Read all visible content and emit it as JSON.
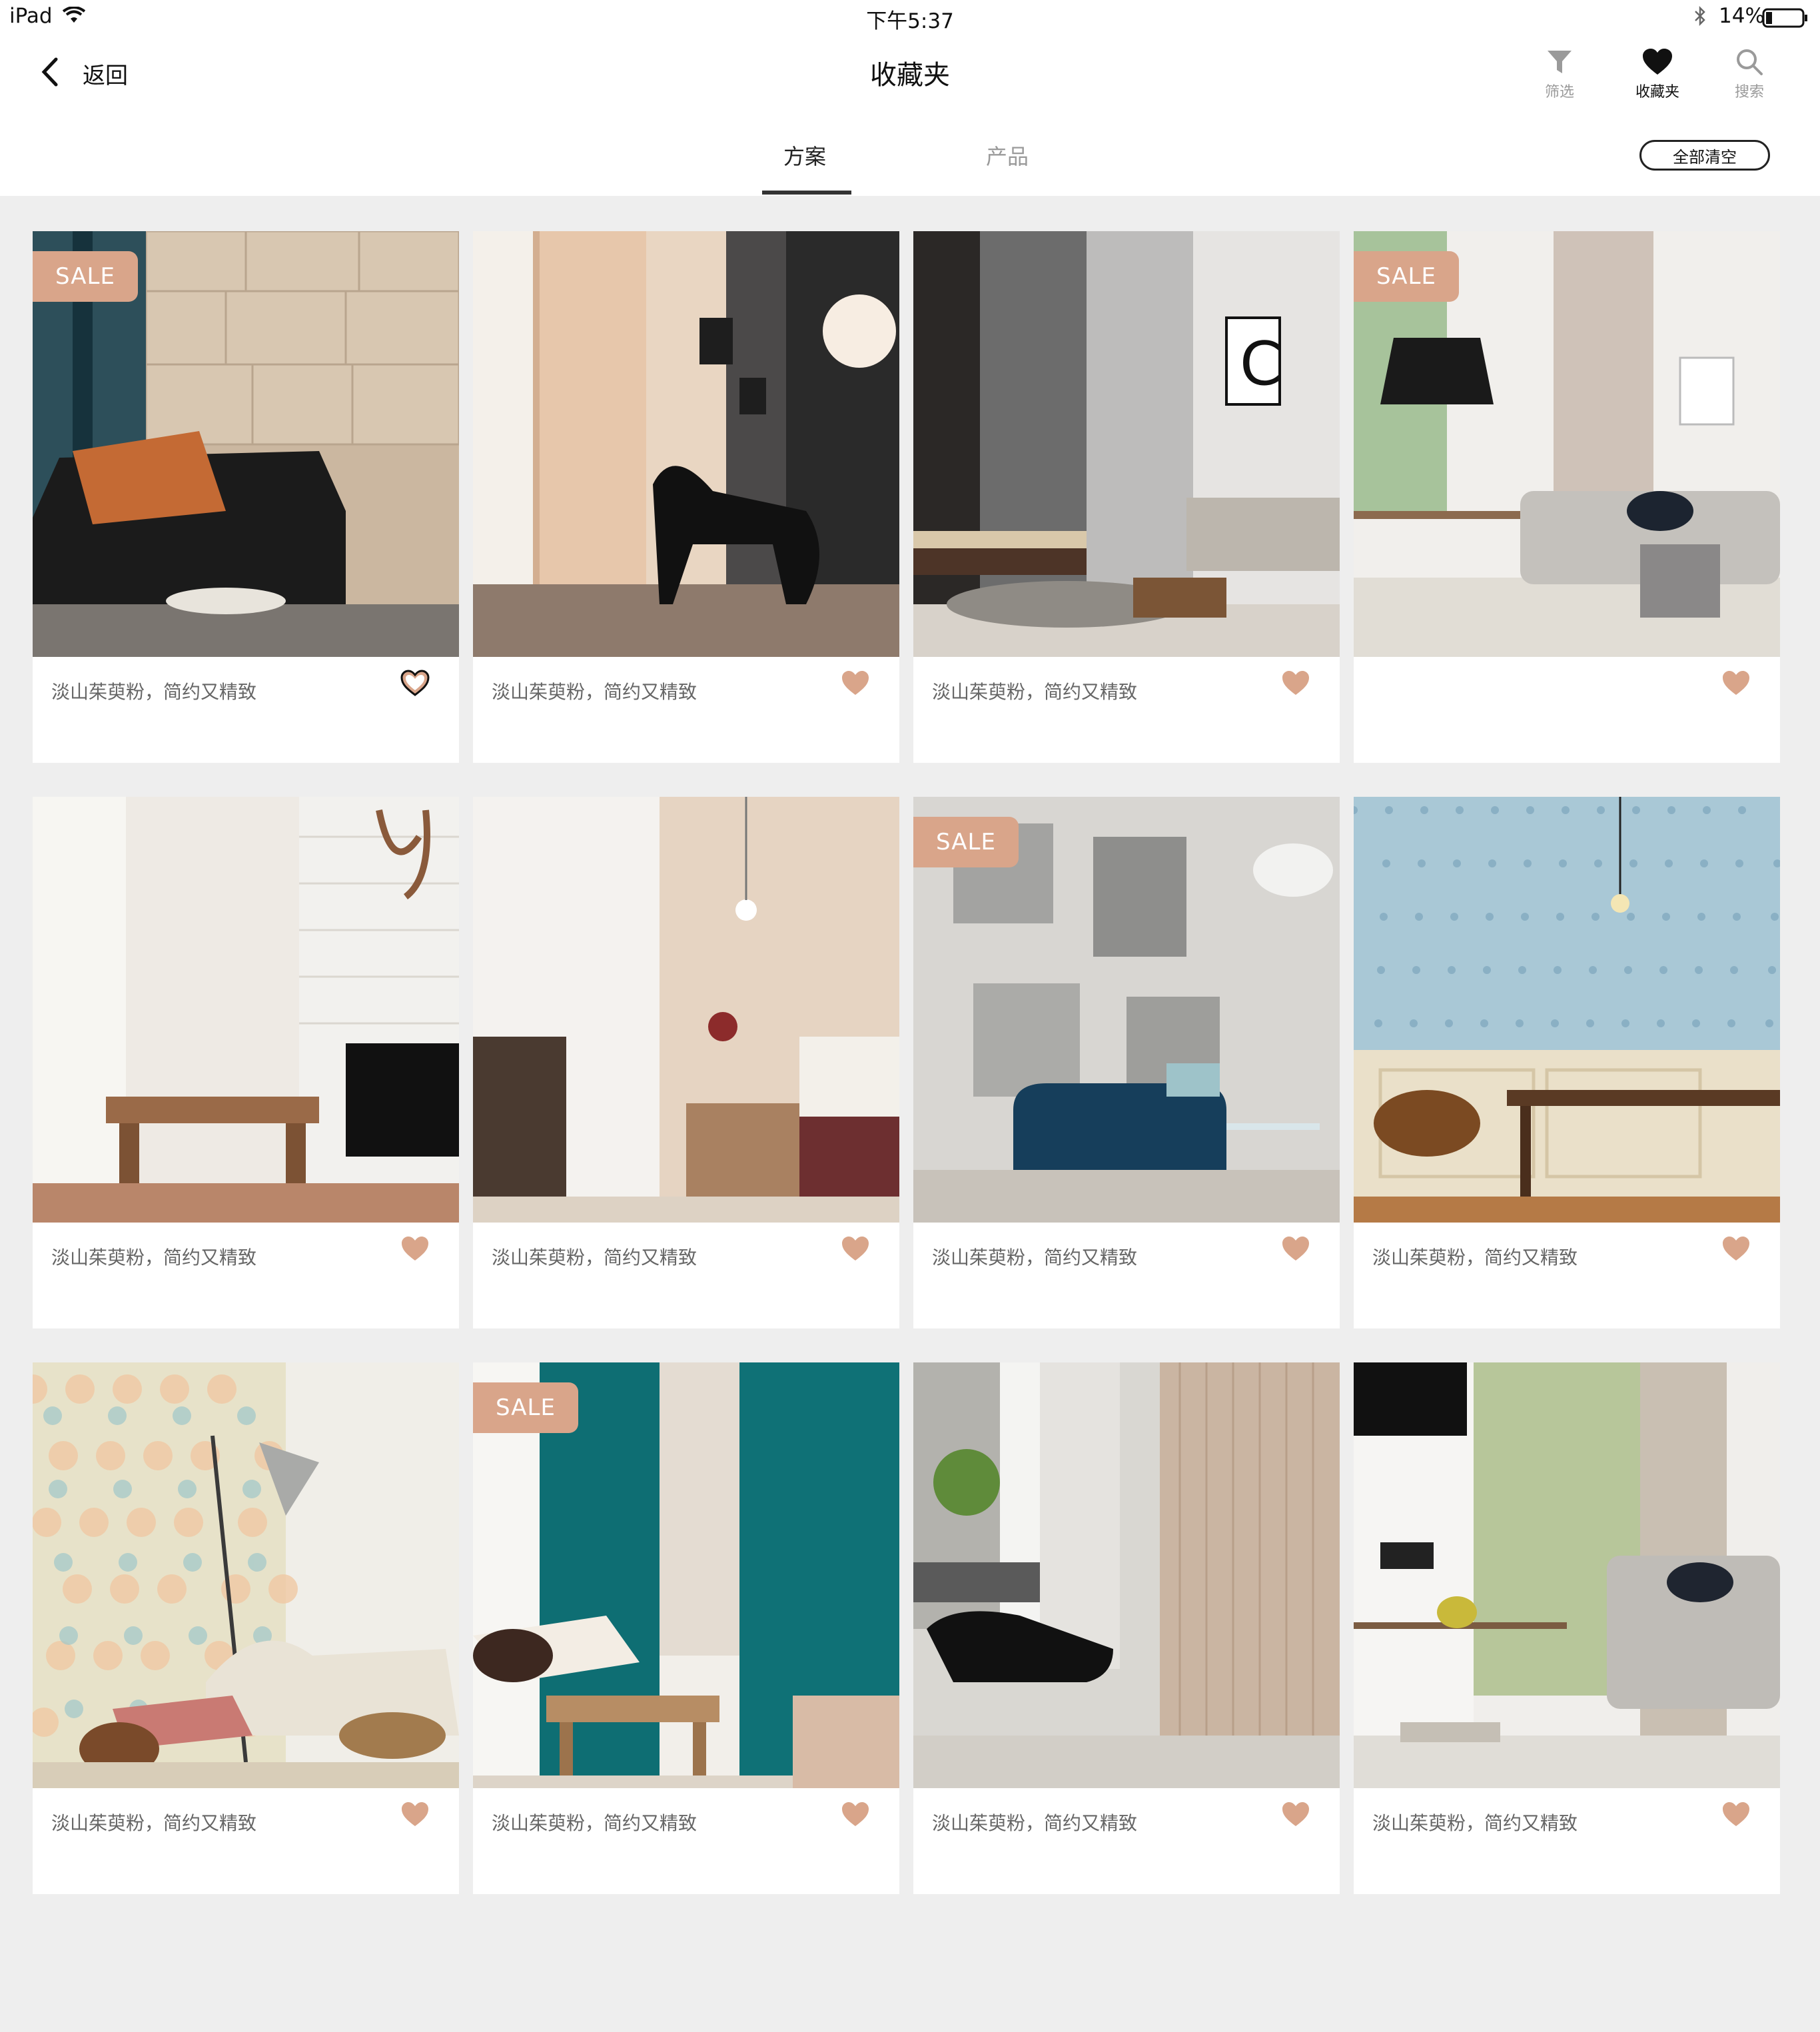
{
  "status_bar": {
    "device": "iPad",
    "time": "下午5:37",
    "battery_percent": "14%"
  },
  "nav": {
    "back_label": "返回",
    "title": "收藏夹",
    "tools": {
      "filter": "筛选",
      "favorites": "收藏夹",
      "search": "搜索"
    }
  },
  "tabs": {
    "plans": "方案",
    "products": "产品",
    "active": "plans"
  },
  "clear_all_label": "全部清空",
  "colors": {
    "accent_heart": "#d9a58a",
    "sale_badge": "#d9a58a",
    "background": "#eeeeee"
  },
  "icons": {
    "back": "chevron-left-icon",
    "filter": "funnel-icon",
    "favorites": "heart-icon",
    "search": "search-icon",
    "wifi": "wifi-icon",
    "bluetooth": "bluetooth-icon",
    "battery": "battery-icon"
  },
  "cards": [
    {
      "caption": "淡山茱萸粉，简约又精致",
      "sale": "SALE",
      "favorited": false,
      "scene": "black leather sofa, stone tile wall"
    },
    {
      "caption": "淡山茱萸粉，简约又精致",
      "sale": "",
      "favorited": true,
      "scene": "peach sheer curtains, lounge chair"
    },
    {
      "caption": "淡山茱萸粉，简约又精致",
      "sale": "",
      "favorited": true,
      "scene": "grey striped curtains, sofa"
    },
    {
      "caption": "",
      "sale": "SALE",
      "favorited": true,
      "scene": "pendant lamp, white sofa"
    },
    {
      "caption": "淡山茱萸粉，简约又精致",
      "sale": "",
      "favorited": true,
      "scene": "white brick fireplace, antlers"
    },
    {
      "caption": "淡山茱萸粉，简约又精致",
      "sale": "",
      "favorited": true,
      "scene": "sheer curtain, bedside table"
    },
    {
      "caption": "淡山茱萸粉，简约又精致",
      "sale": "SALE",
      "favorited": true,
      "scene": "grey mottled wall, navy sofa"
    },
    {
      "caption": "淡山茱萸粉，简约又精致",
      "sale": "",
      "favorited": true,
      "scene": "blue pattern wall, dining table"
    },
    {
      "caption": "淡山茱萸粉，简约又精致",
      "sale": "",
      "favorited": true,
      "scene": "floral wallpaper, floor lamp"
    },
    {
      "caption": "淡山茱萸粉，简约又精致",
      "sale": "SALE",
      "favorited": true,
      "scene": "teal curtains, daybed"
    },
    {
      "caption": "淡山茱萸粉，简约又精致",
      "sale": "",
      "favorited": true,
      "scene": "taupe curtains, black chair"
    },
    {
      "caption": "淡山茱萸粉，简约又精致",
      "sale": "",
      "favorited": true,
      "scene": "black pendant, grey sofa"
    }
  ]
}
